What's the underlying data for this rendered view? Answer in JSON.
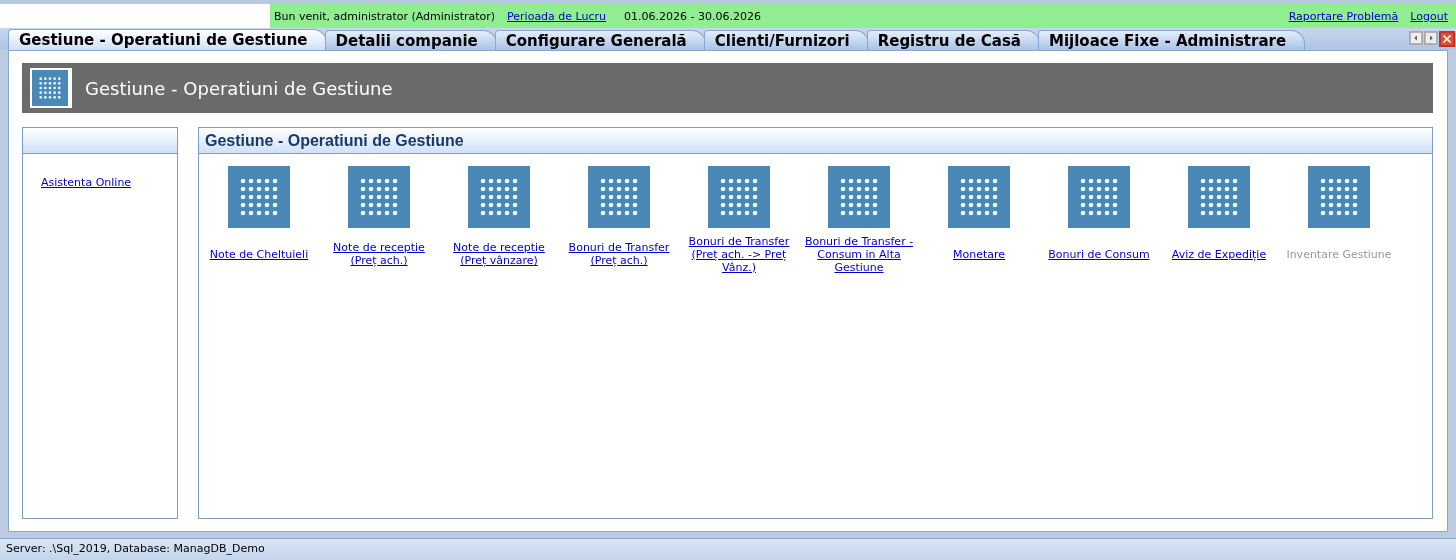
{
  "top_bar": {
    "welcome": "Bun venit, administrator (Administrator)",
    "period_link": "Perioada de Lucru",
    "period": "01.06.2026  -  30.06.2026",
    "report_link": "Raportare Problemă",
    "logout_link": "Logout"
  },
  "tabs": [
    {
      "label": "Gestiune - Operatiuni de Gestiune",
      "selected": true
    },
    {
      "label": "Detalii companie",
      "selected": false
    },
    {
      "label": "Configurare Generală",
      "selected": false
    },
    {
      "label": "Clienti/Furnizori",
      "selected": false
    },
    {
      "label": "Registru de Casă",
      "selected": false
    },
    {
      "label": "Mijloace Fixe - Administrare",
      "selected": false
    }
  ],
  "header": {
    "title": "Gestiune - Operatiuni de Gestiune"
  },
  "sidebar": {
    "items": [
      "Asistenta Online"
    ]
  },
  "panel": {
    "title": "Gestiune - Operatiuni de Gestiune",
    "items": [
      {
        "label": "Note de Cheltuieli",
        "disabled": false
      },
      {
        "label": "Note de receptie (Preț ach.)",
        "disabled": false
      },
      {
        "label": "Note de receptie (Preț vânzare)",
        "disabled": false
      },
      {
        "label": "Bonuri de Transfer (Preț ach.)",
        "disabled": false
      },
      {
        "label": "Bonuri de Transfer (Preț ach. -> Preț Vânz.)",
        "disabled": false
      },
      {
        "label": "Bonuri de Transfer - Consum in Alta Gestiune",
        "disabled": false
      },
      {
        "label": "Monetare",
        "disabled": false
      },
      {
        "label": "Bonuri de Consum",
        "disabled": false
      },
      {
        "label": "Aviz de Expediție",
        "disabled": false
      },
      {
        "label": "Inventare Gestiune",
        "disabled": true
      }
    ]
  },
  "status_bar": "Server: .\\Sql_2019, Database: ManagDB_Demo"
}
